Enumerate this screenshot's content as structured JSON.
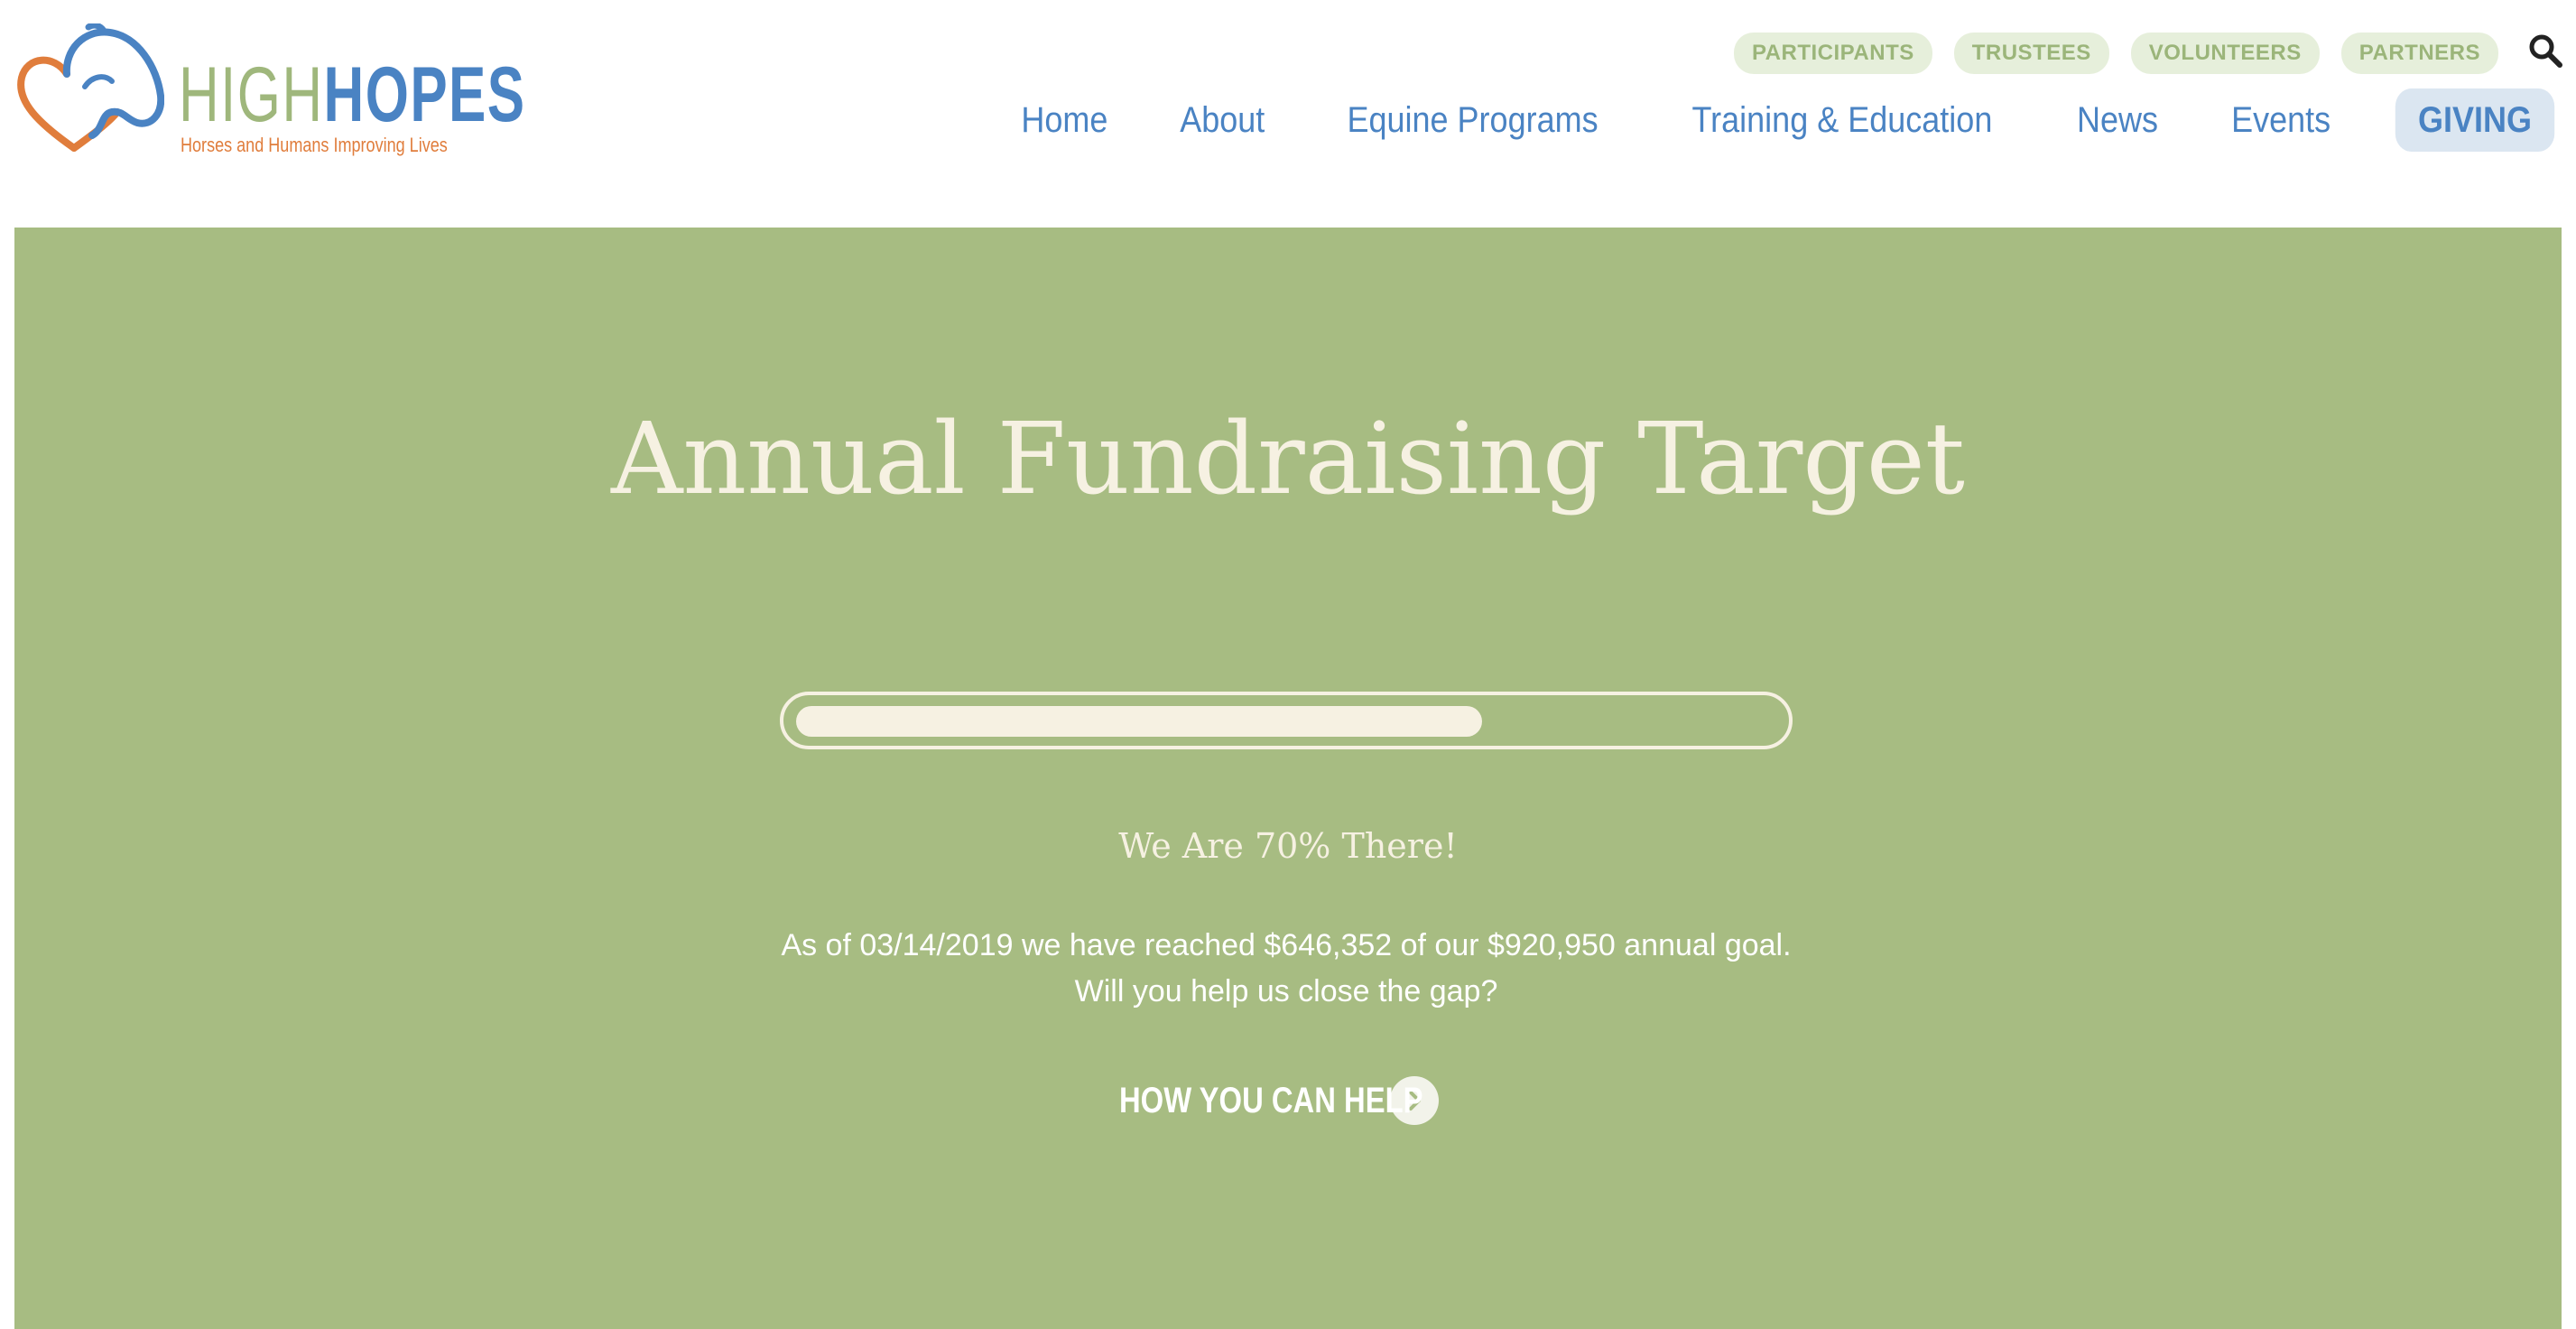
{
  "brand": {
    "name_part1": "HIGH",
    "name_part2": "HOPES",
    "tagline": "Horses and Humans Improving Lives",
    "colors": {
      "green": "#9fb77c",
      "blue": "#4a83c3",
      "orange": "#e07d3c"
    }
  },
  "header": {
    "top_links": [
      {
        "label": "PARTICIPANTS"
      },
      {
        "label": "TRUSTEES"
      },
      {
        "label": "VOLUNTEERS"
      },
      {
        "label": "PARTNERS"
      }
    ],
    "search_icon": "search-icon",
    "nav": [
      {
        "label": "Home"
      },
      {
        "label": "About"
      },
      {
        "label": "Equine Programs"
      },
      {
        "label": "Training & Education"
      },
      {
        "label": "News"
      },
      {
        "label": "Events"
      },
      {
        "label": "GIVING",
        "active": true
      }
    ]
  },
  "hero": {
    "title": "Annual Fundraising Target",
    "progress_fraction": 0.7,
    "subtitle": "We Are 70% There!",
    "body": "As of 03/14/2019 we have reached $646,352 of our $920,950 annual goal. Will you help us close the gap?",
    "cta_label": "HOW YOU CAN HELP",
    "cta_icon": "chevron-right-icon",
    "background_color": "#a7bc82",
    "text_color": "#f6f1e2"
  }
}
